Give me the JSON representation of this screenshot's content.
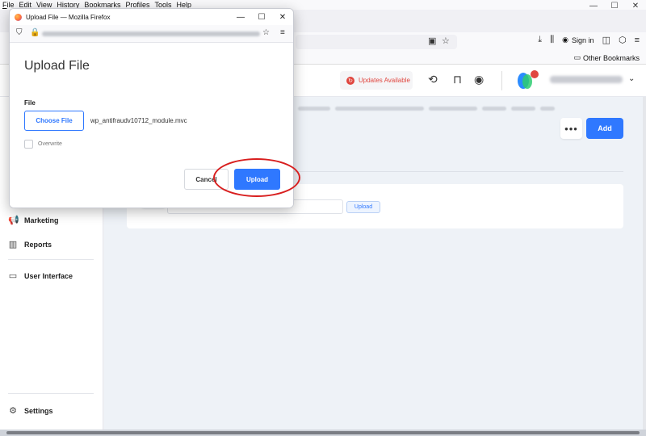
{
  "browser": {
    "menu": [
      "File",
      "Edit",
      "View",
      "History",
      "Bookmarks",
      "Profiles",
      "Tools",
      "Help"
    ],
    "window_controls": {
      "minimize": "—",
      "maximize": "☐",
      "close": "✕"
    },
    "sign_in": "Sign in",
    "other_bookmarks": "Other Bookmarks"
  },
  "app": {
    "updates_label": "Updates Available",
    "add_label": "Add",
    "more_label": "•••",
    "panel_upload_label": "Upload",
    "sidebar": [
      {
        "label": "Marketing",
        "icon": "megaphone-icon"
      },
      {
        "label": "Reports",
        "icon": "bar-chart-icon"
      },
      {
        "label": "User Interface",
        "icon": "window-icon"
      },
      {
        "label": "Settings",
        "icon": "gear-icon"
      }
    ]
  },
  "dialog": {
    "window_title": "Upload File — Mozilla Firefox",
    "heading": "Upload File",
    "file_label": "File",
    "choose_file_label": "Choose File",
    "file_name": "wp_antifraudv10712_module.mvc",
    "overwrite_label": "Overwrite",
    "cancel_label": "Cancel",
    "upload_label": "Upload"
  },
  "colors": {
    "accent": "#2f78ff",
    "updates_red": "#e0463f",
    "annotation_red": "#d81e1e"
  }
}
